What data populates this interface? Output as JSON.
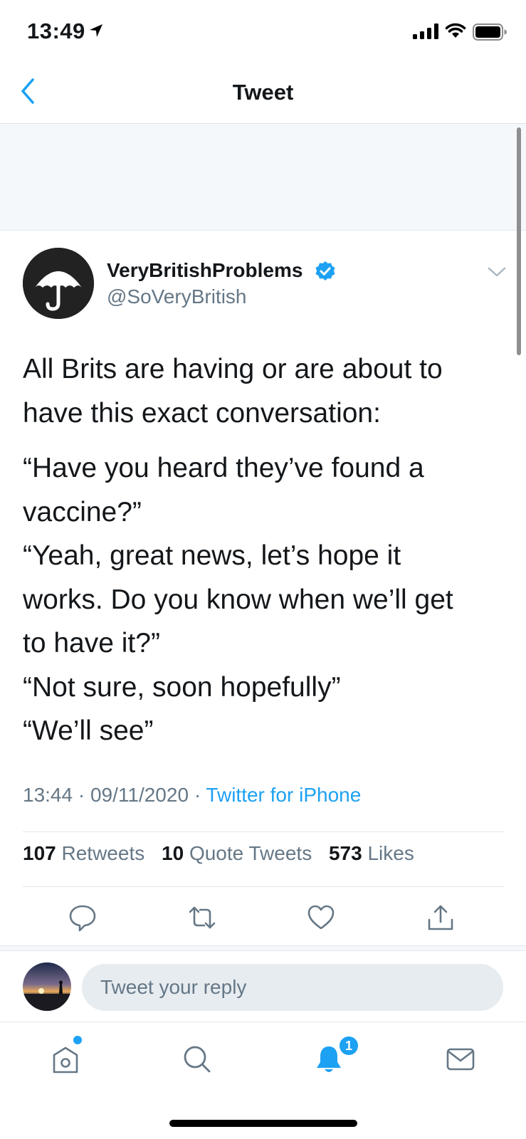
{
  "status_bar": {
    "time": "13:49"
  },
  "nav": {
    "title": "Tweet"
  },
  "tweet": {
    "display_name": "VeryBritishProblems",
    "handle": "@SoVeryBritish",
    "verified": true,
    "lines": [
      "All Brits are having or are about to",
      "have this exact conversation:",
      "“Have you heard they’ve found a",
      "vaccine?”",
      "“Yeah, great news, let’s hope it",
      "works. Do you know when we’ll get",
      "to have it?”",
      "“Not sure, soon hopefully”",
      "“We’ll see”"
    ],
    "time": "13:44",
    "date": "09/11/2020",
    "separator": "·",
    "source": "Twitter for iPhone"
  },
  "stats": {
    "retweets_count": "107",
    "retweets_label": "Retweets",
    "quotes_count": "10",
    "quotes_label": "Quote Tweets",
    "likes_count": "573",
    "likes_label": "Likes"
  },
  "actions": {
    "icons": [
      "reply-icon",
      "retweet-icon",
      "like-icon",
      "share-icon"
    ]
  },
  "reply": {
    "placeholder": "Tweet your reply"
  },
  "tabbar": {
    "icons": [
      "home-icon",
      "search-icon",
      "notifications-icon",
      "messages-icon"
    ],
    "notification_badge": "1"
  },
  "colors": {
    "accent": "#1da1f2",
    "text_primary": "#14171a",
    "text_secondary": "#657786",
    "divider": "#e1e8ed"
  }
}
